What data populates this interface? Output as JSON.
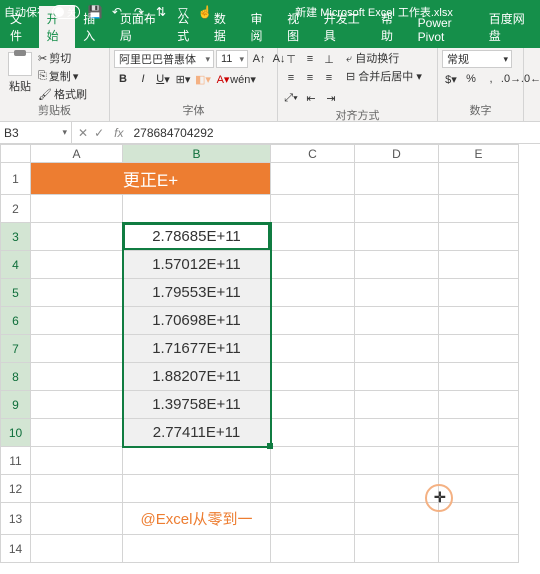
{
  "titlebar": {
    "autosave_label": "自动保存",
    "autosave_state": "关",
    "filename": "新建 Microsoft Excel 工作表.xlsx"
  },
  "tabs": {
    "items": [
      "文件",
      "开始",
      "插入",
      "页面布局",
      "公式",
      "数据",
      "审阅",
      "视图",
      "开发工具",
      "帮助",
      "Power Pivot",
      "百度网盘"
    ],
    "active": 1
  },
  "ribbon": {
    "clipboard": {
      "paste": "粘贴",
      "cut": "剪切",
      "copy": "复制",
      "format_painter": "格式刷",
      "group": "剪贴板"
    },
    "font": {
      "name": "阿里巴巴普惠体",
      "size": "11",
      "group": "字体"
    },
    "align": {
      "wrap": "自动换行",
      "merge": "合并后居中",
      "group": "对齐方式"
    },
    "number": {
      "format": "常规",
      "group": "数字"
    }
  },
  "namebox": "B3",
  "formula": "278684704292",
  "columns": [
    "A",
    "B",
    "C",
    "D",
    "E"
  ],
  "rows": [
    "1",
    "2",
    "3",
    "4",
    "5",
    "6",
    "7",
    "8",
    "9",
    "10",
    "11",
    "12",
    "13",
    "14"
  ],
  "cells": {
    "header": "更正E+",
    "data": [
      "2.78685E+11",
      "1.57012E+11",
      "1.79553E+11",
      "1.70698E+11",
      "1.71677E+11",
      "1.88207E+11",
      "1.39758E+11",
      "2.77411E+11"
    ],
    "watermark": "@Excel从零到一"
  }
}
